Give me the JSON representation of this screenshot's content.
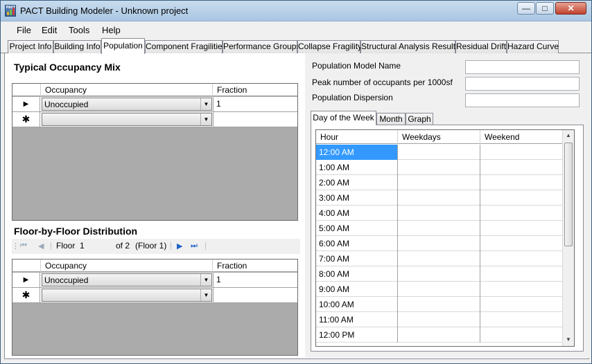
{
  "window": {
    "title": "PACT Building Modeler - Unknown project",
    "icon_label": "PACT"
  },
  "menu": [
    "File",
    "Edit",
    "Tools",
    "Help"
  ],
  "tabs": [
    "Project Info",
    "Building Info",
    "Population",
    "Component Fragilities",
    "Performance Groups",
    "Collapse Fragility",
    "Structural Analysis Results",
    "Residual Drift",
    "Hazard Curve"
  ],
  "active_tab": "Population",
  "occupancy_mix": {
    "title": "Typical Occupancy Mix",
    "col_occupancy": "Occupancy",
    "col_fraction": "Fraction",
    "row_occupancy": "Unoccupied",
    "row_fraction": "1"
  },
  "floor_distribution": {
    "title": "Floor-by-Floor Distribution",
    "floor_label": "Floor",
    "floor_value": "1",
    "of_text": "of 2",
    "floor_caption": "(Floor 1)",
    "col_occupancy": "Occupancy",
    "col_fraction": "Fraction",
    "row_occupancy": "Unoccupied",
    "row_fraction": "1"
  },
  "population_model": {
    "name_label": "Population Model Name",
    "peak_label": "Peak number of occupants per 1000sf",
    "dispersion_label": "Population Dispersion",
    "name_value": "",
    "peak_value": "",
    "dispersion_value": ""
  },
  "subtabs": [
    "Day of the Week",
    "Month",
    "Graph"
  ],
  "active_subtab": "Day of the Week",
  "dow_grid": {
    "headers": [
      "Hour",
      "Weekdays",
      "Weekend"
    ],
    "hours": [
      "12:00 AM",
      "1:00 AM",
      "2:00 AM",
      "3:00 AM",
      "4:00 AM",
      "5:00 AM",
      "6:00 AM",
      "7:00 AM",
      "8:00 AM",
      "9:00 AM",
      "10:00 AM",
      "11:00 AM",
      "12:00 PM"
    ],
    "selected_hour": "12:00 AM"
  },
  "colors": {
    "title_bar": "#b9d1ea",
    "selection": "#3399ff",
    "grid_bg": "#ababab",
    "close_button": "#c0412d"
  }
}
